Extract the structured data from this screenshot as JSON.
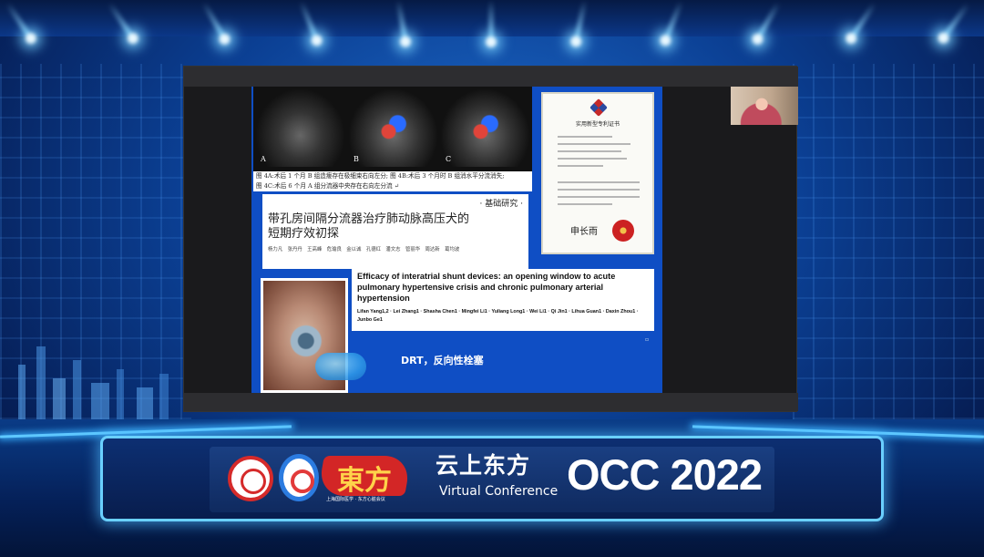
{
  "slide": {
    "echo_labels": [
      "A",
      "B",
      "C"
    ],
    "echo_caption_line1": "图 4A:术后 1 个月 B 组造瘘存在极细束右向左分; 图 4B:术后 3 个月时 B 组消水平分流消失;",
    "echo_caption_line2": "图 4C:术后 6 个月 A 组分流器中央存在右向左分流 ↵",
    "cn_paper_section": "· 基础研究 ·",
    "cn_paper_title_line1": "带孔房间隔分流器治疗肺动脉高压犬的",
    "cn_paper_title_line2": "短期疗效初探",
    "cn_paper_authors": "杨力凡　张丹丹　王高峰　危瑜良　金以诚　孔德红　潘文志　管丽华　周达新　葛均波",
    "certificate_title": "实用新型专利证书",
    "certificate_signature": "申长雨",
    "en_paper_title": "Efficacy of interatrial shunt devices: an opening window to acute pulmonary hypertensive crisis and chronic pulmonary arterial hypertension",
    "en_paper_authors": "Lifan Yang1,2 · Lei Zhang1 · Shasha Chen1 · Mingfei Li1 · Yuliang Long1 · Wei Li1 · Qi Jin1 · Lihua Guan1 · Daxin Zhou1 · Junbo Ge1",
    "drt_label": "DRT，反向性栓塞"
  },
  "stage": {
    "logo_c_text": "東方",
    "logo_c_sub": "上海国际医学 · 东方心脏会议",
    "brand_cloud": "云上东方",
    "brand_virtual": "Virtual Conference",
    "brand_occ": "OCC 2022"
  },
  "colors": {
    "stage_blue": "#0b3f93",
    "slide_blue": "#0f4ec4",
    "glow_cyan": "#5ec8ff",
    "logo_red": "#d32626"
  },
  "icons": [
    "stage-spotlight-icon",
    "society-logo-icon",
    "heart-logo-icon",
    "oriental-logo-icon",
    "cloud-logo-icon",
    "certificate-emblem-icon",
    "certificate-seal-icon"
  ]
}
